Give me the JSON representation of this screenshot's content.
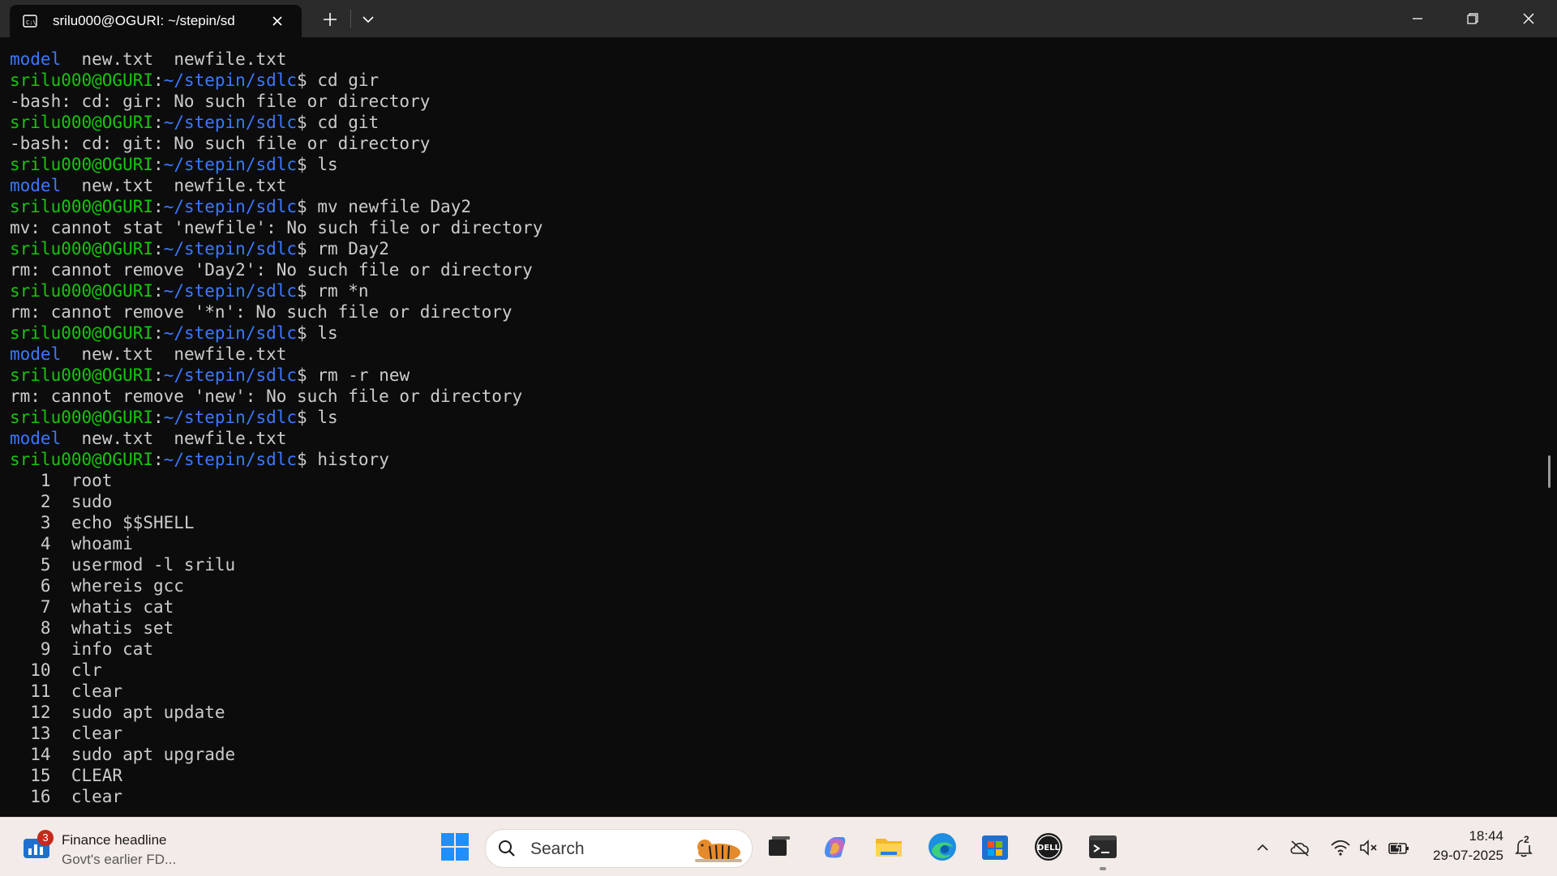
{
  "window": {
    "tab_title": "srilu000@OGURI: ~/stepin/sd",
    "tab_close_label": "×"
  },
  "terminal": {
    "prompt_user": "srilu000@OGURI",
    "prompt_path": "~/stepin/sdlc",
    "lines": [
      {
        "type": "ls",
        "items": [
          "model",
          "new.txt",
          "newfile.txt"
        ]
      },
      {
        "type": "cmd",
        "cmd": "cd gir"
      },
      {
        "type": "out",
        "text": "-bash: cd: gir: No such file or directory"
      },
      {
        "type": "cmd",
        "cmd": "cd git"
      },
      {
        "type": "out",
        "text": "-bash: cd: git: No such file or directory"
      },
      {
        "type": "cmd",
        "cmd": "ls"
      },
      {
        "type": "ls",
        "items": [
          "model",
          "new.txt",
          "newfile.txt"
        ]
      },
      {
        "type": "cmd",
        "cmd": "mv newfile Day2"
      },
      {
        "type": "out",
        "text": "mv: cannot stat 'newfile': No such file or directory"
      },
      {
        "type": "cmd",
        "cmd": "rm Day2"
      },
      {
        "type": "out",
        "text": "rm: cannot remove 'Day2': No such file or directory"
      },
      {
        "type": "cmd",
        "cmd": "rm *n"
      },
      {
        "type": "out",
        "text": "rm: cannot remove '*n': No such file or directory"
      },
      {
        "type": "cmd",
        "cmd": "ls"
      },
      {
        "type": "ls",
        "items": [
          "model",
          "new.txt",
          "newfile.txt"
        ]
      },
      {
        "type": "cmd",
        "cmd": "rm -r new"
      },
      {
        "type": "out",
        "text": "rm: cannot remove 'new': No such file or directory"
      },
      {
        "type": "cmd",
        "cmd": "ls"
      },
      {
        "type": "ls",
        "items": [
          "model",
          "new.txt",
          "newfile.txt"
        ]
      },
      {
        "type": "cmd",
        "cmd": "history"
      },
      {
        "type": "hist",
        "num": "1",
        "cmd": "root"
      },
      {
        "type": "hist",
        "num": "2",
        "cmd": "sudo"
      },
      {
        "type": "hist",
        "num": "3",
        "cmd": "echo $$SHELL"
      },
      {
        "type": "hist",
        "num": "4",
        "cmd": "whoami"
      },
      {
        "type": "hist",
        "num": "5",
        "cmd": "usermod -l srilu"
      },
      {
        "type": "hist",
        "num": "6",
        "cmd": "whereis gcc"
      },
      {
        "type": "hist",
        "num": "7",
        "cmd": "whatis cat"
      },
      {
        "type": "hist",
        "num": "8",
        "cmd": "whatis set"
      },
      {
        "type": "hist",
        "num": "9",
        "cmd": "info cat"
      },
      {
        "type": "hist",
        "num": "10",
        "cmd": "clr"
      },
      {
        "type": "hist",
        "num": "11",
        "cmd": "clear"
      },
      {
        "type": "hist",
        "num": "12",
        "cmd": "sudo apt update"
      },
      {
        "type": "hist",
        "num": "13",
        "cmd": "clear"
      },
      {
        "type": "hist",
        "num": "14",
        "cmd": "sudo apt upgrade"
      },
      {
        "type": "hist",
        "num": "15",
        "cmd": "CLEAR"
      },
      {
        "type": "hist",
        "num": "16",
        "cmd": "clear"
      }
    ]
  },
  "taskbar": {
    "widget_badge": "3",
    "widget_title": "Finance headline",
    "widget_subtitle": "Govt's earlier FD...",
    "search_placeholder": "Search",
    "time": "18:44",
    "date": "29-07-2025",
    "notification_count": "2"
  },
  "colors": {
    "terminal_bg": "#0c0c0c",
    "prompt_user": "#16c60c",
    "prompt_path": "#3b78ff",
    "directory": "#3b78ff",
    "text": "#cccccc",
    "taskbar_bg": "#f3ebe7"
  }
}
